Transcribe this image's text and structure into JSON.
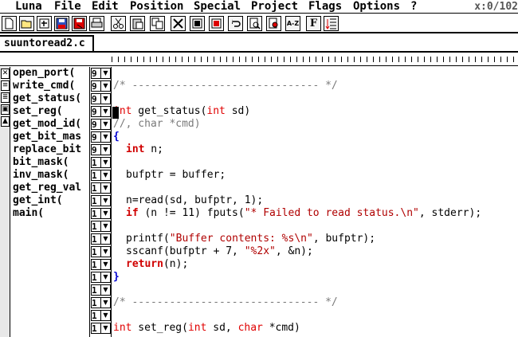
{
  "menubar": {
    "items": [
      "Luna",
      "File",
      "Edit",
      "Position",
      "Special",
      "Project",
      "Flags",
      "Options",
      "?"
    ],
    "coords": "x:0/102"
  },
  "toolbar": {
    "buttons": [
      {
        "name": "new-file-icon"
      },
      {
        "name": "open-file-icon"
      },
      {
        "name": "new-window-icon"
      },
      {
        "name": "save-icon"
      },
      {
        "name": "save-as-icon"
      },
      {
        "name": "print-icon"
      },
      {
        "name": "cut-icon"
      },
      {
        "name": "paste-icon"
      },
      {
        "name": "copy-icon"
      },
      {
        "name": "delete-block-icon"
      },
      {
        "name": "mark-block-icon"
      },
      {
        "name": "unmark-block-icon"
      },
      {
        "name": "undo-icon"
      },
      {
        "name": "find-icon"
      },
      {
        "name": "find-replace-icon"
      },
      {
        "name": "sort-icon",
        "label": "A-Z"
      },
      {
        "name": "font-icon",
        "label": "F"
      },
      {
        "name": "indent-icon"
      }
    ]
  },
  "tab": {
    "label": "suuntoread2.c"
  },
  "functions": [
    "open_port(",
    "write_cmd(",
    "get_status(",
    "set_reg(",
    "get_mod_id(",
    "get_bit_mas",
    "replace_bit",
    "bit_mask(",
    "inv_mask(",
    "get_reg_val",
    "get_int(",
    "main("
  ],
  "markers": [
    "9",
    "9",
    "9",
    "9",
    "9",
    "9",
    "9",
    "1",
    "1",
    "1",
    "1",
    "1",
    "1",
    "1",
    "1",
    "1",
    "1",
    "1",
    "1",
    "1",
    "1",
    "1"
  ],
  "code": {
    "l1_comment": "/* ------------------------------ */",
    "l2_type": "int",
    "l2_rest": " get_status(",
    "l2_type2": "int",
    "l2_end": " sd)",
    "l3_comment": "//, char *cmd)",
    "l4_brace": "{",
    "l5_type": "int",
    "l5_rest": " n;",
    "l7": "bufptr = buffer;",
    "l9_a": "n=read(sd, bufptr, 1);",
    "l10_kw": "if",
    "l10_a": " (n != 11) fputs(",
    "l10_str": "\"* Failed to read status.\\n\"",
    "l10_b": ", stderr);",
    "l12_a": "printf(",
    "l12_str": "\"Buffer contents: %s\\n\"",
    "l12_b": ", bufptr);",
    "l13_a": "sscanf(bufptr + 7, ",
    "l13_str": "\"%2x\"",
    "l13_b": ", &n);",
    "l14_kw": "return",
    "l14_b": "(n);",
    "l15_brace": "}",
    "l17_comment": "/* ------------------------------ */",
    "l19_type": "int",
    "l19_rest": " set_reg(",
    "l19_type2": "int",
    "l19_mid": " sd, ",
    "l19_type3": "char",
    "l19_end": " *cmd)"
  }
}
